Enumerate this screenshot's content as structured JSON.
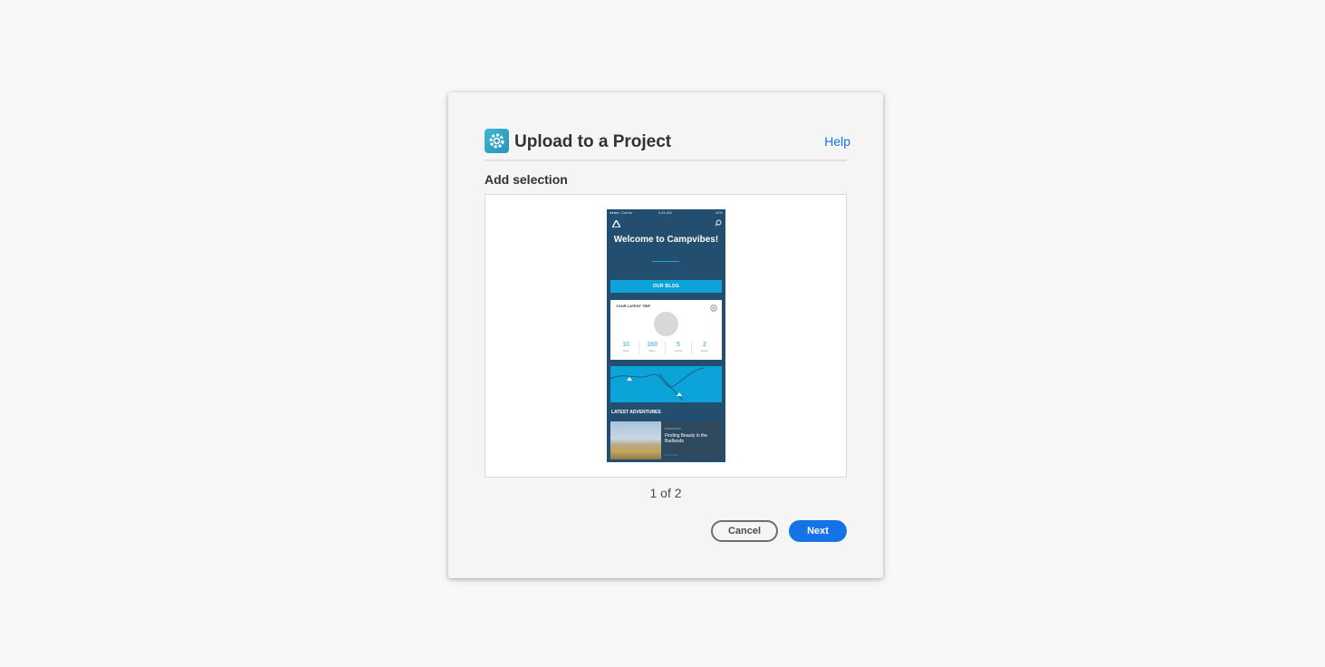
{
  "dialog": {
    "title": "Upload to a Project",
    "help_label": "Help",
    "section_label": "Add selection",
    "pager": "1 of 2",
    "cancel_label": "Cancel",
    "next_label": "Next",
    "app_icon": "gear-icon",
    "accent_color": "#1473e6"
  },
  "preview": {
    "status_left": "●●●●○ Carrier",
    "status_time": "9:41 AM",
    "status_right": "42%",
    "welcome": "Welcome to Campvibes!",
    "blog_button": "OUR BLOG",
    "trip_title": "YOUR LATEST TRIP",
    "stats": [
      {
        "value": "10",
        "label": "Days"
      },
      {
        "value": "160",
        "label": "Miles"
      },
      {
        "value": "5",
        "label": "Camps"
      },
      {
        "value": "2",
        "label": "Bears"
      }
    ],
    "adventures_label": "LATEST ADVENTURES",
    "adventure_category": "Adventure",
    "adventure_title": "Finding Beauty in the Badlands",
    "adventure_more": "4 min read"
  }
}
